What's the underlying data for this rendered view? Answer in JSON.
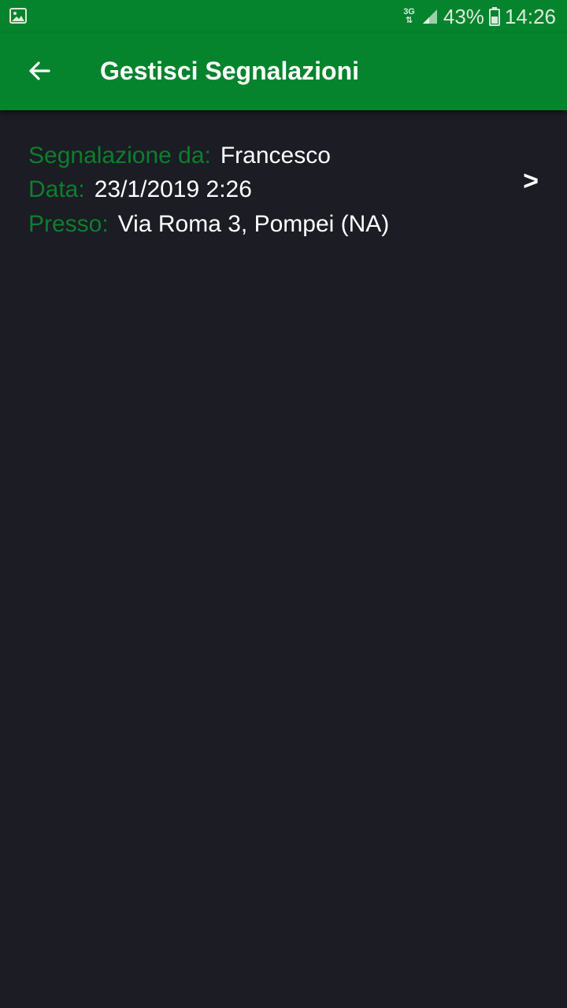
{
  "status_bar": {
    "network_type": "3G",
    "battery_percent": "43%",
    "time": "14:26",
    "icons": [
      "gallery-notification-icon",
      "signal-icon",
      "battery-icon"
    ]
  },
  "app_bar": {
    "title": "Gestisci Segnalazioni",
    "back_icon": "arrow-back-icon",
    "background_color": "#06832d"
  },
  "report": {
    "sender_label": "Segnalazione da:",
    "sender_value": "Francesco",
    "date_label": "Data:",
    "date_value": "23/1/2019 2:26",
    "location_label": "Presso:",
    "location_value": "Via Roma 3, Pompei (NA)",
    "chevron": ">"
  },
  "colors": {
    "label": "#0c7f2c",
    "value": "#ffffff",
    "background": "#1b1c24"
  }
}
